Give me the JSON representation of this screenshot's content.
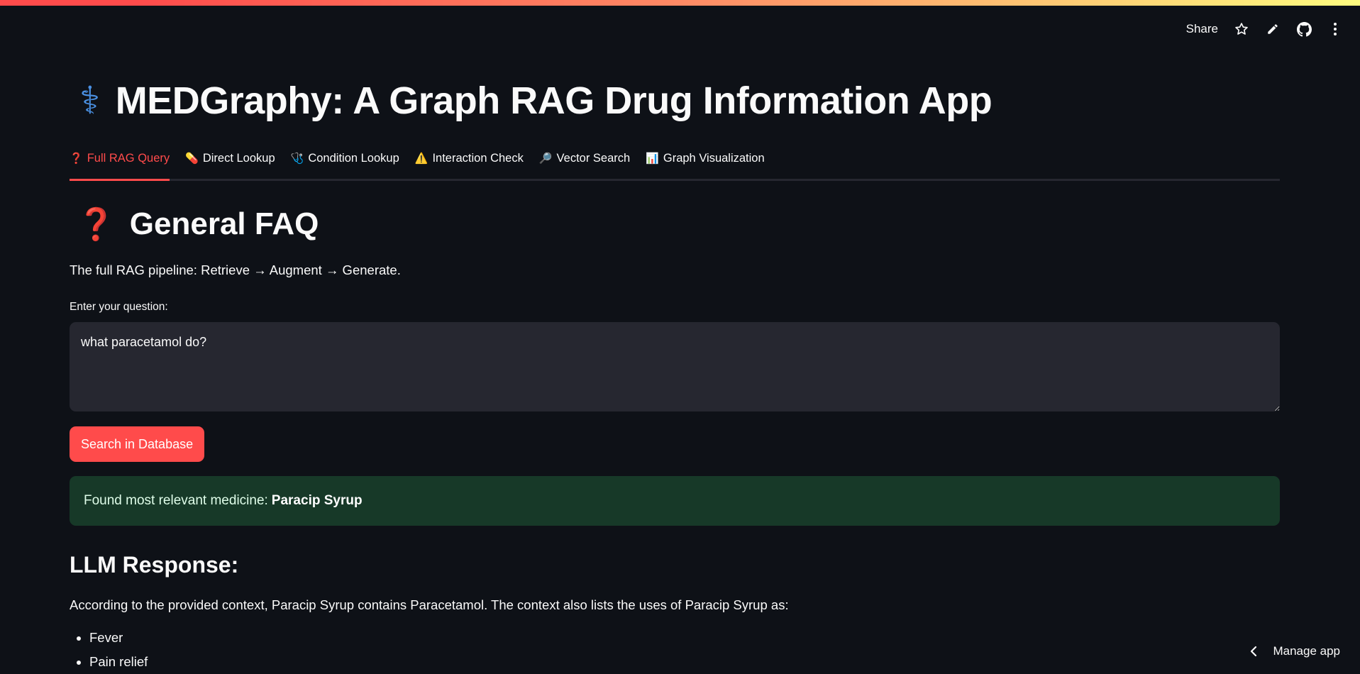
{
  "toolbar": {
    "share_label": "Share",
    "icons": [
      "star-icon",
      "pencil-icon",
      "github-icon",
      "more-vertical-icon"
    ]
  },
  "app": {
    "title": "MEDGraphy: A Graph RAG Drug Information App",
    "icon": "caduceus-icon"
  },
  "tabs": [
    {
      "icon": "❓",
      "label": "Full RAG Query",
      "active": true
    },
    {
      "icon": "💊",
      "label": "Direct Lookup",
      "active": false
    },
    {
      "icon": "🩺",
      "label": "Condition Lookup",
      "active": false
    },
    {
      "icon": "⚠️",
      "label": "Interaction Check",
      "active": false
    },
    {
      "icon": "🔎",
      "label": "Vector Search",
      "active": false
    },
    {
      "icon": "📊",
      "label": "Graph Visualization",
      "active": false
    }
  ],
  "section": {
    "icon": "❓",
    "title": "General FAQ",
    "caption": "The full RAG pipeline: Retrieve → Augment → Generate."
  },
  "question": {
    "label": "Enter your question:",
    "value": "what paracetamol do?"
  },
  "search_button": "Search in Database",
  "result": {
    "prefix": "Found most relevant medicine:",
    "medicine": "Paracip Syrup"
  },
  "llm": {
    "heading": "LLM Response:",
    "text": "According to the provided context, Paracip Syrup contains Paracetamol. The context also lists the uses of Paracip Syrup as:",
    "uses": [
      "Fever",
      "Pain relief"
    ]
  },
  "manage_app": "Manage app",
  "colors": {
    "background": "#0e1117",
    "accent": "#ff4b4b",
    "input_bg": "#262730",
    "success_bg": "#173928"
  }
}
